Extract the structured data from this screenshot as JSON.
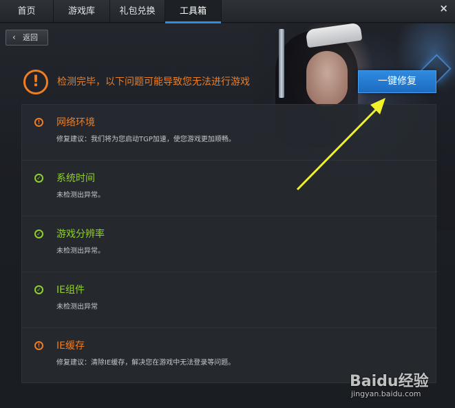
{
  "nav": {
    "tabs": [
      {
        "label": "首页"
      },
      {
        "label": "游戏库"
      },
      {
        "label": "礼包兑换"
      },
      {
        "label": "工具箱"
      }
    ],
    "active_tab": "工具箱",
    "close_glyph": "×"
  },
  "back": {
    "label": "返回",
    "icon": "chevron-left-icon"
  },
  "result": {
    "headline": "检测完毕，以下问题可能导致您无法进行游戏",
    "fix_button": "一键修复"
  },
  "items": [
    {
      "status": "warning",
      "title": "网络环境",
      "desc": "修复建议：我们将为您启动TGP加速，使您游戏更加顺畅。"
    },
    {
      "status": "ok",
      "title": "系统时间",
      "desc": "未检测出异常。"
    },
    {
      "status": "ok",
      "title": "游戏分辨率",
      "desc": "未检测出异常。"
    },
    {
      "status": "ok",
      "title": "IE组件",
      "desc": "未检测出异常"
    },
    {
      "status": "warning",
      "title": "IE缓存",
      "desc": "修复建议：清除IE缓存，解决您在游戏中无法登录等问题。"
    }
  ],
  "watermark": {
    "logo": "Baidu经验",
    "url": "jingyan.baidu.com"
  },
  "colors": {
    "warning": "#f07d22",
    "ok": "#8fd12a",
    "accent": "#2a8fe0",
    "arrow": "#f2f22a"
  }
}
